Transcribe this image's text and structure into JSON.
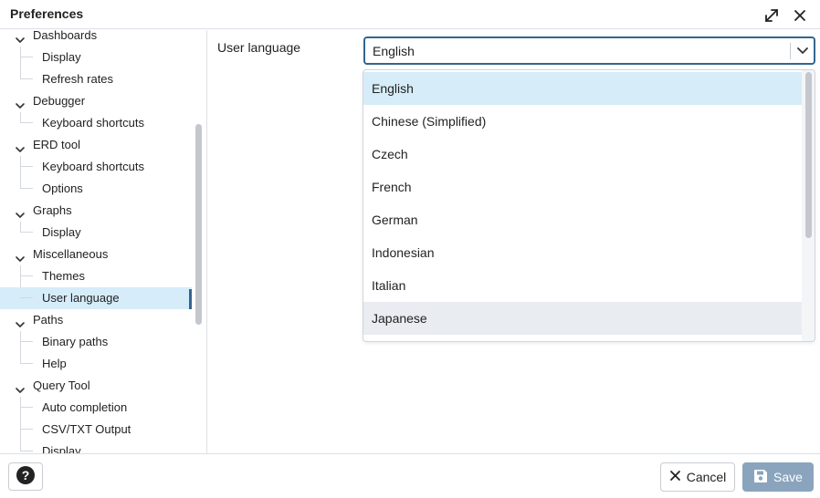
{
  "dialog": {
    "title": "Preferences",
    "expand_icon": "expand-diagonal-icon",
    "close_icon": "close-icon"
  },
  "sidebar": {
    "groups": [
      {
        "label": "Dashboards",
        "children": [
          "Display",
          "Refresh rates"
        ]
      },
      {
        "label": "Debugger",
        "children": [
          "Keyboard shortcuts"
        ]
      },
      {
        "label": "ERD tool",
        "children": [
          "Keyboard shortcuts",
          "Options"
        ]
      },
      {
        "label": "Graphs",
        "children": [
          "Display"
        ]
      },
      {
        "label": "Miscellaneous",
        "children": [
          "Themes",
          "User language"
        ]
      },
      {
        "label": "Paths",
        "children": [
          "Binary paths",
          "Help"
        ]
      },
      {
        "label": "Query Tool",
        "children": [
          "Auto completion",
          "CSV/TXT Output",
          "Display"
        ]
      }
    ],
    "selected": "User language"
  },
  "form": {
    "label": "User language",
    "select_value": "English"
  },
  "dropdown": {
    "options": [
      "English",
      "Chinese (Simplified)",
      "Czech",
      "French",
      "German",
      "Indonesian",
      "Italian",
      "Japanese"
    ],
    "selected_index": 0,
    "hover_index": 7
  },
  "footer": {
    "help_icon": "question-circle-icon",
    "cancel_label": "Cancel",
    "save_label": "Save"
  },
  "colors": {
    "accent": "#326690",
    "selection": "#d6ecf9",
    "hover": "#e9ecf0",
    "save_disabled": "#8aa4bd"
  }
}
